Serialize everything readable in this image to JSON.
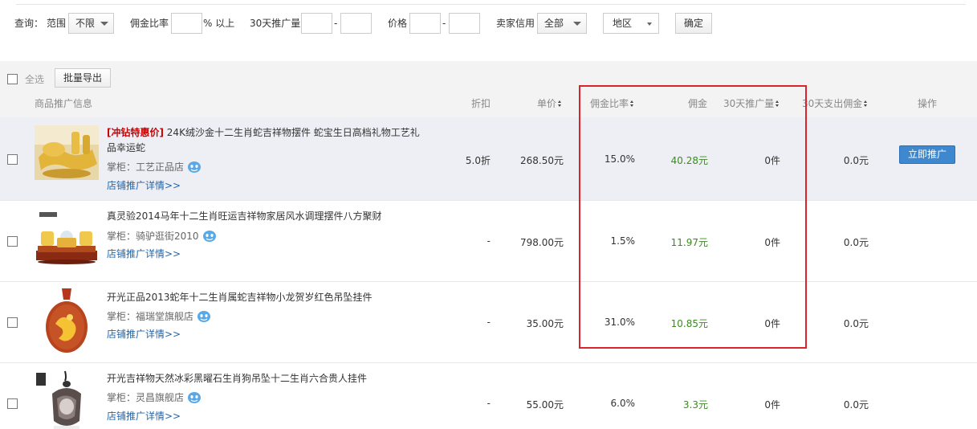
{
  "filter": {
    "query_label": "查询：",
    "range_label": "范围",
    "range_value": "不限",
    "commission_label": "佣金比率",
    "commission_suffix": "% 以上",
    "promo30_label": "30天推广量",
    "dash": "-",
    "price_label": "价格",
    "credit_label": "卖家信用",
    "credit_value": "全部",
    "region_value": "地区",
    "confirm_label": "确定"
  },
  "toolbar": {
    "select_all_label": "全选",
    "export_label": "批量导出"
  },
  "columns": {
    "info": "商品推广信息",
    "discount": "折扣",
    "unit_price": "单价",
    "commission_rate": "佣金比率",
    "commission": "佣金",
    "promo30": "30天推广量",
    "paid30": "30天支出佣金",
    "action": "操作"
  },
  "rows": [
    {
      "promo_tag": "[冲钻特惠价]",
      "title": " 24K绒沙金十二生肖蛇吉祥物摆件 蛇宝生日高档礼物工艺礼品幸运蛇",
      "seller_prefix": "掌柜：",
      "seller": "工艺正品店",
      "detail_link": "店铺推广详情>>",
      "discount": "5.0折",
      "unit_price": "268.50元",
      "commission_rate": "15.0%",
      "commission": "40.28元",
      "promo30": "0件",
      "paid30": "0.0元",
      "action": "立即推广"
    },
    {
      "promo_tag": "",
      "title": "真灵验2014马年十二生肖旺运吉祥物家居风水调理摆件八方聚财",
      "seller_prefix": "掌柜：",
      "seller": "骑驴逛街2010",
      "detail_link": "店铺推广详情>>",
      "discount": "-",
      "unit_price": "798.00元",
      "commission_rate": "1.5%",
      "commission": "11.97元",
      "promo30": "0件",
      "paid30": "0.0元",
      "action": ""
    },
    {
      "promo_tag": "",
      "title": "开光正品2013蛇年十二生肖属蛇吉祥物小龙贺岁红色吊坠挂件",
      "seller_prefix": "掌柜：",
      "seller": "福瑞堂旗舰店",
      "detail_link": "店铺推广详情>>",
      "discount": "-",
      "unit_price": "35.00元",
      "commission_rate": "31.0%",
      "commission": "10.85元",
      "promo30": "0件",
      "paid30": "0.0元",
      "action": ""
    },
    {
      "promo_tag": "",
      "title": "开光吉祥物天然冰彩黑曜石生肖狗吊坠十二生肖六合贵人挂件",
      "seller_prefix": "掌柜：",
      "seller": "灵昌旗舰店",
      "detail_link": "店铺推广详情>>",
      "discount": "-",
      "unit_price": "55.00元",
      "commission_rate": "6.0%",
      "commission": "3.3元",
      "promo30": "0件",
      "paid30": "0.0元",
      "action": ""
    }
  ],
  "colors": {
    "highlight_row": "#eeeff5",
    "commission_green": "#3a8b1e",
    "link_blue": "#2266aa",
    "button_blue": "#3e88d0",
    "annotation_red": "#d8242b"
  }
}
